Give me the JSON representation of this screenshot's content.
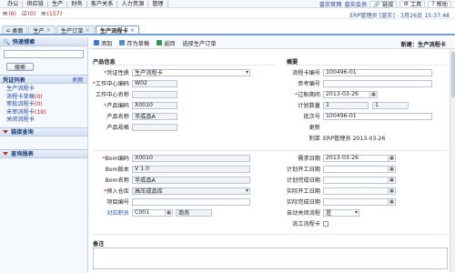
{
  "topmenu": [
    "办公",
    "供应链",
    "生产",
    "财务",
    "客户关系",
    "人力资源",
    "管理"
  ],
  "topright": {
    "website": "普实官网",
    "company": "普实会员",
    "links": "链接",
    "tools": "工具",
    "help": "帮助"
  },
  "row2": {
    "count1": "(6)",
    "count2": "(0)",
    "count3": "(157)",
    "user": "ERP管理员 [普实] - 3月26日 15:37:48"
  },
  "tabs": [
    {
      "label": "桌面"
    },
    {
      "label": "生产"
    },
    {
      "label": "生产订单"
    },
    {
      "label": "生产流程卡"
    }
  ],
  "sidebar": {
    "quick_search": "快速搜索",
    "search_btn": "搜索",
    "voucher_list": "凭证列表",
    "refresh": "刷新",
    "items": [
      {
        "label": "生产流程卡",
        "count": ""
      },
      {
        "label": "流程卡草稿",
        "count": "(0)"
      },
      {
        "label": "审批流程卡",
        "count": "(0)"
      },
      {
        "label": "未审流程卡",
        "count": "(19)"
      },
      {
        "label": "关闭流程卡",
        "count": ""
      }
    ],
    "link_query": "链接查询",
    "report": "查询报表"
  },
  "toolbar": {
    "add": "添加",
    "save_draft": "存为草稿",
    "back": "返回",
    "select_order": "选择生产订单",
    "new_label": "新建：生产流程卡"
  },
  "product_info": {
    "title": "产品信息",
    "voucher_type_label": "凭证性质",
    "voucher_type": "生产流程卡",
    "workcenter_code_label": "工作中心编码",
    "workcenter_code": "W02",
    "workcenter_name_label": "工作中心名称",
    "workcenter_name": "",
    "product_code_label": "产品编码",
    "product_code": "X0010",
    "product_name_label": "产品名称",
    "product_name": "半成品A",
    "product_spec_label": "产品规格",
    "product_spec": ""
  },
  "summary": {
    "title": "概要",
    "card_no_label": "流程卡编号",
    "card_no": "100496-01",
    "ref_no_label": "参考编号",
    "ref_no": "",
    "date_label": "过账期间",
    "date": "2013-03-26",
    "plan_qty_label": "计划数量",
    "plan_qty": "1",
    "plan_qty2": "1",
    "batch_label": "批次号",
    "batch": "100496-01",
    "update_label": "更新",
    "update": "",
    "creator_label": "制单",
    "creator": "ERP管理员 2013-03-26"
  },
  "bom": {
    "bom_code_label": "Bom编码",
    "bom_code": "X0010",
    "bom_ver_label": "Bom版本",
    "bom_ver": "V 1.0",
    "bom_name_label": "Bom名称",
    "bom_name": "半成品A",
    "warehouse_label": "预入仓库",
    "warehouse": "高压成品库",
    "project_label": "项目编号",
    "project": "",
    "staff_label": "对应职员",
    "staff_code": "C001",
    "staff_name": "商务"
  },
  "schedule": {
    "req_date_label": "需求日期",
    "req_date": "2013-03-26",
    "plan_start_label": "计划开工日期",
    "plan_end_label": "计划完成日期",
    "act_start_label": "实际开工日期",
    "act_end_label": "实际完成日期",
    "auto_close_label": "自动关闭流程",
    "auto_close": "是",
    "proc_card_label": "流工流程卡"
  },
  "remark": {
    "label": "备注"
  }
}
